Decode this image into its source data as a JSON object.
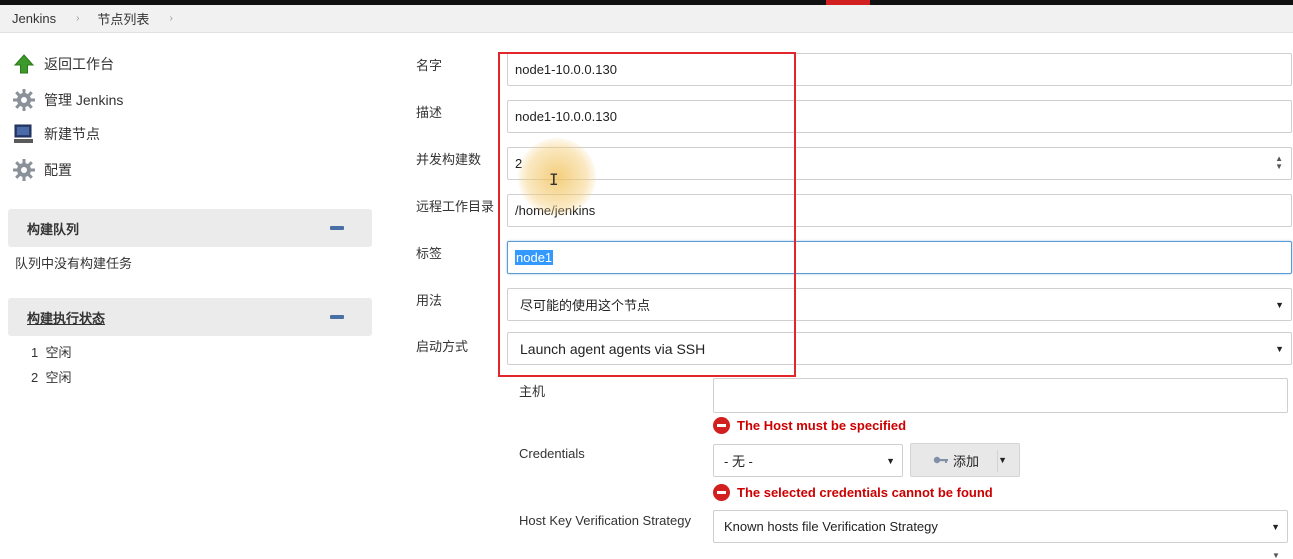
{
  "breadcrumb": {
    "items": [
      "Jenkins",
      "节点列表"
    ],
    "separator": "›"
  },
  "sidebar": {
    "tasks": [
      {
        "label": "返回工作台",
        "icon": "up-arrow-icon"
      },
      {
        "label": "管理 Jenkins",
        "icon": "gear-icon"
      },
      {
        "label": "新建节点",
        "icon": "computer-icon"
      },
      {
        "label": "配置",
        "icon": "gear-icon"
      }
    ],
    "build_queue": {
      "title": "构建队列",
      "empty_text": "队列中没有构建任务"
    },
    "executor_status": {
      "title": "构建执行状态",
      "executors": [
        {
          "number": "1",
          "status": "空闲"
        },
        {
          "number": "2",
          "status": "空闲"
        }
      ]
    }
  },
  "form": {
    "name": {
      "label": "名字",
      "value": "node1-10.0.0.130"
    },
    "description": {
      "label": "描述",
      "value": "node1-10.0.0.130"
    },
    "executors": {
      "label": "并发构建数",
      "value": "2"
    },
    "remote_dir": {
      "label": "远程工作目录",
      "value": "/home/jenkins"
    },
    "labels": {
      "label": "标签",
      "value": "node1"
    },
    "usage": {
      "label": "用法",
      "value": "尽可能的使用这个节点"
    },
    "launch_method": {
      "label": "启动方式",
      "value": "Launch agent agents via SSH"
    },
    "host": {
      "label": "主机",
      "value": "",
      "error": "The Host must be specified"
    },
    "credentials": {
      "label": "Credentials",
      "value": "- 无 -",
      "add_label": "添加",
      "error": "The selected credentials cannot be found"
    },
    "host_key": {
      "label": "Host Key Verification Strategy",
      "value": "Known hosts file Verification Strategy"
    }
  },
  "colors": {
    "error": "#cc0000",
    "highlight_box": "#e2262b",
    "focus_border": "#5b9bd5",
    "selection": "#3399ff"
  }
}
